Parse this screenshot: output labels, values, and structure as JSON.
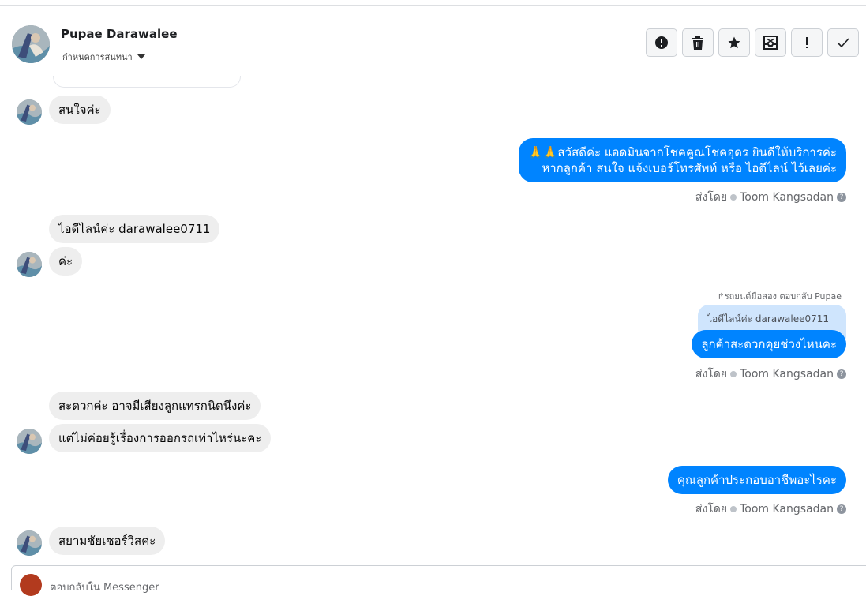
{
  "header": {
    "contact_name": "Pupae Darawalee",
    "conversation_setting": "กำหนดการสนทนา",
    "toolbar": [
      "report-icon",
      "trash-icon",
      "star-icon",
      "archive-icon",
      "mark-important-icon",
      "done-check-icon"
    ]
  },
  "messages": {
    "in_1": "สนใจค่ะ",
    "out_1_line1": "🙏🙏สวัสดีค่ะ แอดมินจากโชคคูณโชคอุดร ยินดีให้บริการค่ะ",
    "out_1_line2": "หากลูกค้า สนใจ แจ้งเบอร์โทรศัพท์ หรือ ไอดีไลน์  ไว้เลยค่ะ",
    "sentby_1_label": "ส่งโดย",
    "sentby_1_name": "Toom Kangsadan",
    "in_2": "ไอดีไลน์ค่ะ darawalee0711",
    "in_3": "ค่ะ",
    "reply_meta": "↱รถยนต์มือสอง ตอบกลับ Pupae",
    "quoted_text": "ไอดีไลน์ค่ะ darawalee0711",
    "out_2": "ลูกค้าสะดวกคุยช่วงไหนคะ",
    "sentby_2_label": "ส่งโดย",
    "sentby_2_name": "Toom Kangsadan",
    "in_4": "สะดวกค่ะ อาจมีเสียงลูกแทรกนิดนึงค่ะ",
    "in_5": "แต่ไม่ค่อยรู้เรื่องการออกรถเท่าไหร่นะคะ",
    "out_3": "คุณลูกค้าประกอบอาชีพอะไรคะ",
    "sentby_3_label": "ส่งโดย",
    "sentby_3_name": "Toom Kangsadan",
    "in_6": "สยามชัยเซอร์วิสค่ะ"
  },
  "composer": {
    "placeholder": "ตอบกลับใน Messenger"
  },
  "colors": {
    "outgoing_bubble": "#0084ff",
    "incoming_bubble": "#eeeeee",
    "quote_bubble": "#cfe5fd"
  }
}
